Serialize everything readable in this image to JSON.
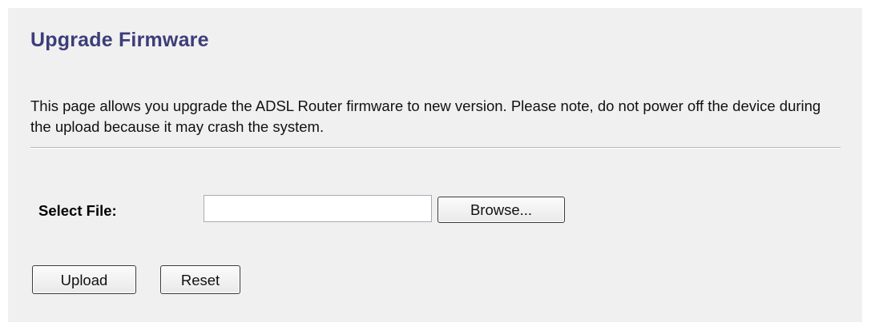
{
  "page": {
    "title": "Upgrade Firmware",
    "description": "This page allows you upgrade the ADSL Router firmware to new version. Please note, do not power off the device during the upload because it may crash the system."
  },
  "form": {
    "file_label": "Select File:",
    "file_value": "",
    "browse_label": "Browse...",
    "upload_label": "Upload",
    "reset_label": "Reset"
  },
  "colors": {
    "title": "#3d3d7a",
    "panel_background": "#f0f0f0",
    "page_background": "#ffffff"
  }
}
